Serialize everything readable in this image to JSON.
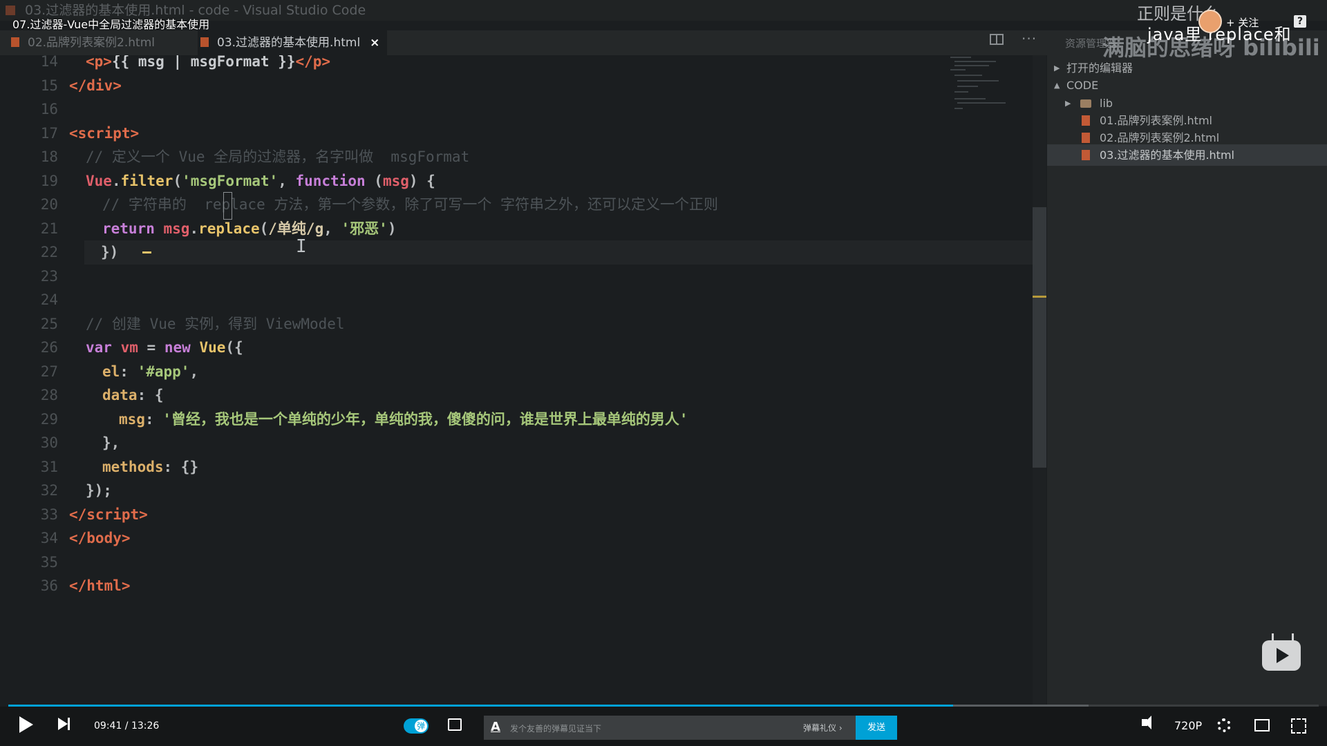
{
  "window": {
    "title": "03.过滤器的基本使用.html - code - Visual Studio Code"
  },
  "video": {
    "title": "07.过滤器-Vue中全局过滤器的基本使用"
  },
  "tabs": [
    {
      "label": "02.品牌列表案例2.html",
      "active": false
    },
    {
      "label": "03.过滤器的基本使用.html",
      "active": true,
      "close": "×"
    }
  ],
  "code_lines": [
    {
      "n": "14",
      "html": "<span class=\"t-tag\">&lt;p&gt;</span><span class=\"t-plain\">{{ msg | msgFormat }}</span><span class=\"t-tag\">&lt;/p&gt;</span>",
      "indent": 2
    },
    {
      "n": "15",
      "html": "<span class=\"t-tag\">&lt;/div&gt;</span>",
      "indent": 1
    },
    {
      "n": "16",
      "html": "",
      "indent": 0
    },
    {
      "n": "17",
      "html": "<span class=\"t-tag\">&lt;script&gt;</span>",
      "indent": 1
    },
    {
      "n": "18",
      "html": "<span class=\"t-com\">// 定义一个 Vue 全局的过滤器，名字叫做  msgFormat</span>",
      "indent": 2
    },
    {
      "n": "19",
      "html": "<span class=\"t-var\">Vue</span><span class=\"t-punc\">.</span><span class=\"t-func\">filter</span><span class=\"t-punc\">(</span><span class=\"t-str\">'msgFormat'</span><span class=\"t-punc\">, </span><span class=\"t-key\">function</span><span class=\"t-punc\"> (</span><span class=\"t-var\">msg</span><span class=\"t-punc\">) {</span>",
      "indent": 2
    },
    {
      "n": "20",
      "html": "<span class=\"t-com\">// 字符串的  replace 方法，第一个参数，除了可写一个 字符串之外，还可以定义一个正则</span>",
      "indent": 3
    },
    {
      "n": "21",
      "html": "<span class=\"t-key\">return</span> <span class=\"t-var\">msg</span><span class=\"t-punc\">.</span><span class=\"t-func\">replace</span><span class=\"t-punc\">(</span><span class=\"t-regex\">/单纯/g</span><span class=\"t-punc\">, </span><span class=\"t-str\">'邪恶'</span><span class=\"t-punc\">)</span>",
      "indent": 3
    },
    {
      "n": "22",
      "html": "<span class=\"t-punc\">})</span>",
      "indent": 2,
      "current": true
    },
    {
      "n": "23",
      "html": "",
      "indent": 0
    },
    {
      "n": "24",
      "html": "",
      "indent": 0
    },
    {
      "n": "25",
      "html": "<span class=\"t-com\">// 创建 Vue 实例，得到 ViewModel</span>",
      "indent": 2
    },
    {
      "n": "26",
      "html": "<span class=\"t-key\">var</span> <span class=\"t-var\">vm</span> <span class=\"t-punc\">=</span> <span class=\"t-key\">new</span> <span class=\"t-func\">Vue</span><span class=\"t-punc\">({</span>",
      "indent": 2
    },
    {
      "n": "27",
      "html": "<span class=\"t-prop\">el</span><span class=\"t-punc\">: </span><span class=\"t-str\">'#app'</span><span class=\"t-punc\">,</span>",
      "indent": 3
    },
    {
      "n": "28",
      "html": "<span class=\"t-prop\">data</span><span class=\"t-punc\">: {</span>",
      "indent": 3
    },
    {
      "n": "29",
      "html": "<span class=\"t-prop\">msg</span><span class=\"t-punc\">: </span><span class=\"t-str\">'曾经，我也是一个单纯的少年，单纯的我，傻傻的问，谁是世界上最单纯的男人'</span>",
      "indent": 4
    },
    {
      "n": "30",
      "html": "<span class=\"t-punc\">},</span>",
      "indent": 3
    },
    {
      "n": "31",
      "html": "<span class=\"t-prop\">methods</span><span class=\"t-punc\">: {}</span>",
      "indent": 3
    },
    {
      "n": "32",
      "html": "<span class=\"t-punc\">});</span>",
      "indent": 2
    },
    {
      "n": "33",
      "html": "<span class=\"t-tag\">&lt;/script&gt;</span>",
      "indent": 1
    },
    {
      "n": "34",
      "html": "<span class=\"t-tag\">&lt;/body&gt;</span>",
      "indent": 0
    },
    {
      "n": "35",
      "html": "",
      "indent": 0
    },
    {
      "n": "36",
      "html": "<span class=\"t-tag\">&lt;/html&gt;</span>",
      "indent": 0
    }
  ],
  "sidebar": {
    "header": "资源管理器",
    "watermark": "满脑的思绪呀 bilibili",
    "sections": {
      "open_editors": "打开的编辑器",
      "workspace": "CODE"
    },
    "tree": [
      {
        "label": "lib",
        "kind": "folder"
      },
      {
        "label": "01.品牌列表案例.html",
        "kind": "file"
      },
      {
        "label": "02.品牌列表案例2.html",
        "kind": "file"
      },
      {
        "label": "03.过滤器的基本使用.html",
        "kind": "file",
        "selected": true
      }
    ]
  },
  "overlay": {
    "danmu_top": "正则是什么",
    "danmu_second": "java里 replace和",
    "follow": "+ 关注",
    "help": "?",
    "win_close": "✕"
  },
  "player": {
    "time_current": "09:41",
    "time_total": "13:26",
    "time_sep": " / ",
    "progress_ratio": 0.7208,
    "danmu_toggle_label": "弹",
    "danmu_placeholder": "发个友善的弹幕见证当下",
    "danmu_etiquette": "弹幕礼仪 ›",
    "send_label": "发送",
    "quality": "720P",
    "colors": {
      "accent": "#00a1d6"
    }
  }
}
